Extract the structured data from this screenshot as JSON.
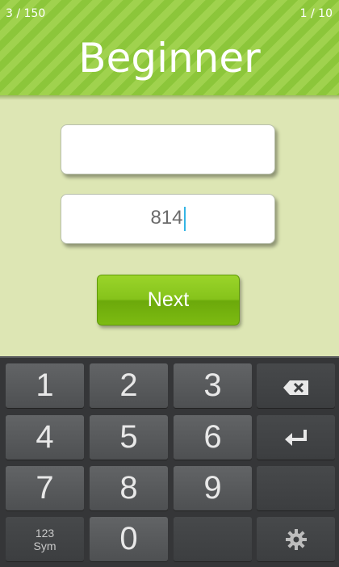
{
  "header": {
    "progress_left": "3 / 150",
    "progress_right": "1 / 10",
    "title": "Beginner"
  },
  "fields": {
    "field1_value": "",
    "field2_value": "814"
  },
  "next_button": "Next",
  "keyboard": {
    "keys": [
      "1",
      "2",
      "3",
      "4",
      "5",
      "6",
      "7",
      "8",
      "9",
      "0"
    ],
    "sym_line1": "123",
    "sym_line2": "Sym",
    "backspace_icon": "backspace-icon",
    "enter_icon": "enter-icon",
    "settings_icon": "gear-icon"
  },
  "colors": {
    "header_green": "#8cc63a",
    "background": "#dde6b4",
    "caret": "#33b5e5",
    "button_green": "#86c31b",
    "keyboard_bg": "#353638"
  }
}
